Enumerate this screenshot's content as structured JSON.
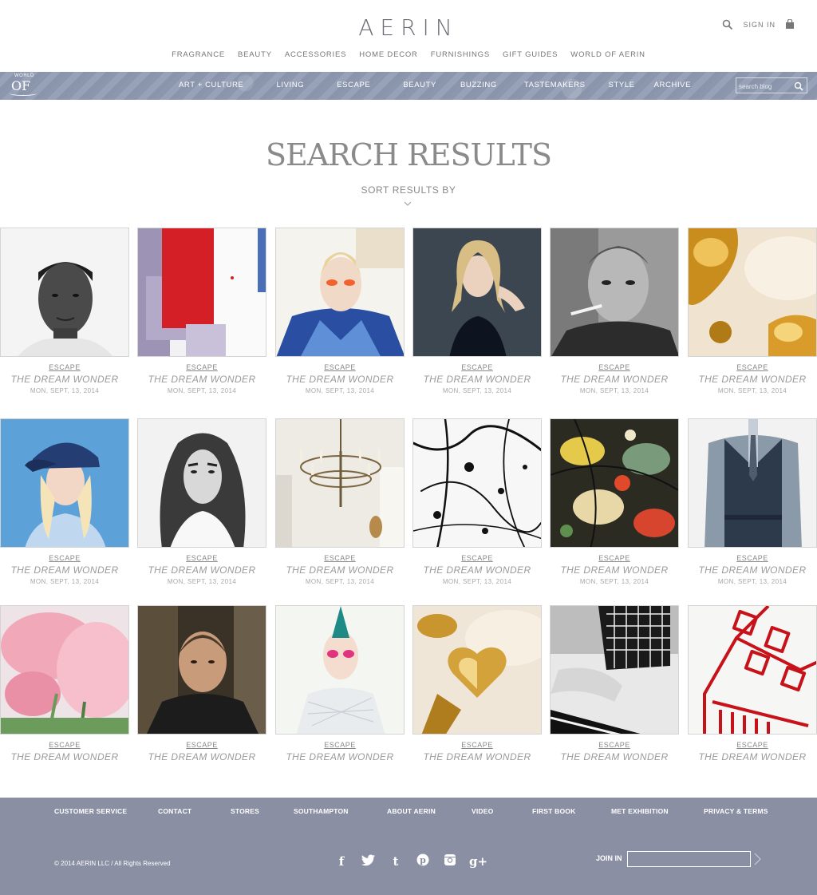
{
  "header": {
    "logo": "AERIN",
    "sign_in": "SIGN IN",
    "nav": [
      "FRAGRANCE",
      "BEAUTY",
      "ACCESSORIES",
      "HOME DECOR",
      "FURNISHINGS",
      "GIFT GUIDES",
      "WORLD OF AERIN"
    ]
  },
  "blog_bar": {
    "logo_small": "WORLD",
    "logo_big": "OF",
    "nav": [
      "ART + CULTURE",
      "LIVING",
      "ESCAPE",
      "BEAUTY",
      "BUZZING",
      "TASTEMAKERS",
      "STYLE",
      "ARCHIVE"
    ],
    "search_placeholder": "search blog"
  },
  "page": {
    "title": "SEARCH RESULTS",
    "sort_label": "SORT RESULTS BY"
  },
  "results": [
    {
      "category": "ESCAPE",
      "title": "THE DREAM WONDER",
      "date": "MON, SEPT, 13, 2014",
      "image": "portrait-man-bw"
    },
    {
      "category": "ESCAPE",
      "title": "THE DREAM WONDER",
      "date": "MON, SEPT, 13, 2014",
      "image": "abstract-red-lavender-paint"
    },
    {
      "category": "ESCAPE",
      "title": "THE DREAM WONDER",
      "date": "MON, SEPT, 13, 2014",
      "image": "fashion-model-blue-jacket"
    },
    {
      "category": "ESCAPE",
      "title": "THE DREAM WONDER",
      "date": "MON, SEPT, 13, 2014",
      "image": "blonde-woman-dark-background"
    },
    {
      "category": "ESCAPE",
      "title": "THE DREAM WONDER",
      "date": "MON, SEPT, 13, 2014",
      "image": "man-smoking-bw"
    },
    {
      "category": "ESCAPE",
      "title": "THE DREAM WONDER",
      "date": "MON, SEPT, 13, 2014",
      "image": "gold-objects"
    },
    {
      "category": "ESCAPE",
      "title": "THE DREAM WONDER",
      "date": "MON, SEPT, 13, 2014",
      "image": "woman-blue-cap"
    },
    {
      "category": "ESCAPE",
      "title": "THE DREAM WONDER",
      "date": "MON, SEPT, 13, 2014",
      "image": "woman-portrait-bw"
    },
    {
      "category": "ESCAPE",
      "title": "THE DREAM WONDER",
      "date": "MON, SEPT, 13, 2014",
      "image": "chandelier-interior"
    },
    {
      "category": "ESCAPE",
      "title": "THE DREAM WONDER",
      "date": "MON, SEPT, 13, 2014",
      "image": "ink-splatter"
    },
    {
      "category": "ESCAPE",
      "title": "THE DREAM WONDER",
      "date": "MON, SEPT, 13, 2014",
      "image": "color-splatter-painting"
    },
    {
      "category": "ESCAPE",
      "title": "THE DREAM WONDER",
      "date": "MON, SEPT, 13, 2014",
      "image": "man-in-vest"
    },
    {
      "category": "ESCAPE",
      "title": "THE DREAM WONDER",
      "image": "pink-flower"
    },
    {
      "category": "ESCAPE",
      "title": "THE DREAM WONDER",
      "image": "old-man-portrait"
    },
    {
      "category": "ESCAPE",
      "title": "THE DREAM WONDER",
      "image": "model-pink-makeup"
    },
    {
      "category": "ESCAPE",
      "title": "THE DREAM WONDER",
      "image": "gold-heart"
    },
    {
      "category": "ESCAPE",
      "title": "THE DREAM WONDER",
      "image": "legs-mesh-skirt-bw"
    },
    {
      "category": "ESCAPE",
      "title": "THE DREAM WONDER",
      "image": "red-line-drawing"
    }
  ],
  "footer": {
    "links": [
      "CUSTOMER SERVICE",
      "CONTACT",
      "STORES",
      "SOUTHAMPTON",
      "ABOUT AERIN",
      "VIDEO",
      "FIRST BOOK",
      "MET EXHIBITION",
      "PRIVACY & TERMS"
    ],
    "copyright": "© 2014 AERIN LLC / All Rights Reserved",
    "social": [
      {
        "glyph": "f",
        "icon": "facebook-icon"
      },
      {
        "glyph": "🐦",
        "icon": "twitter-icon"
      },
      {
        "glyph": "t",
        "icon": "tumblr-icon"
      },
      {
        "glyph": "P",
        "icon": "pinterest-icon"
      },
      {
        "glyph": "▣",
        "icon": "instagram-icon"
      },
      {
        "glyph": "g+",
        "icon": "google-plus-icon"
      }
    ],
    "join_label": "JOIN IN"
  },
  "colors": {
    "blog_bar": "#8c97ae",
    "footer": "#8a8fa3",
    "text_gray": "#777777"
  }
}
